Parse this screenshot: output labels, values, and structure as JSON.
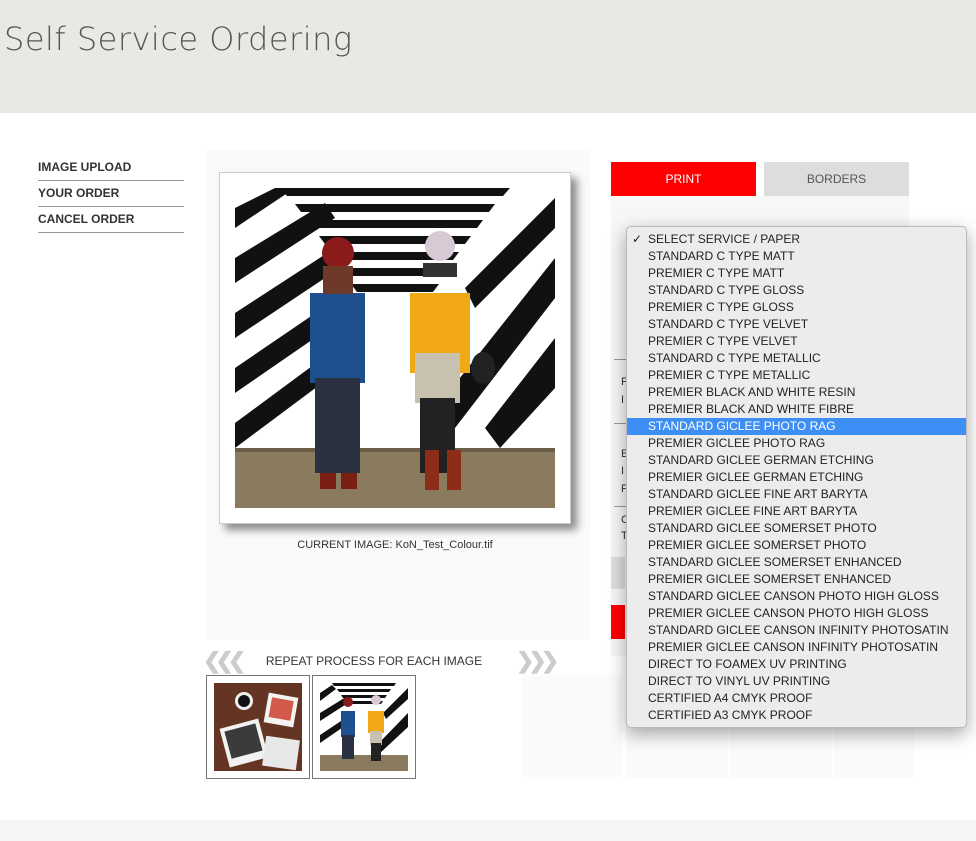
{
  "header": {
    "title": "Self Service Ordering"
  },
  "sidebar": {
    "items": [
      {
        "label": "IMAGE UPLOAD"
      },
      {
        "label": "YOUR ORDER"
      },
      {
        "label": "CANCEL ORDER"
      }
    ]
  },
  "preview": {
    "caption": "CURRENT IMAGE: KoN_Test_Colour.tif"
  },
  "repeat": {
    "label": "REPEAT PROCESS FOR EACH IMAGE",
    "left_arrow": "❮❮❮",
    "right_arrow": "❯❯❯"
  },
  "tabs": [
    {
      "label": "PRINT"
    },
    {
      "label": "BORDERS"
    }
  ],
  "partial_labels": [
    "F",
    "I",
    "E",
    "I",
    "F",
    "C",
    "T"
  ],
  "dropdown": {
    "checkmark": "✓",
    "options": [
      "SELECT SERVICE / PAPER",
      "STANDARD C TYPE MATT",
      "PREMIER C TYPE MATT",
      "STANDARD C TYPE GLOSS",
      "PREMIER C TYPE GLOSS",
      "STANDARD C TYPE VELVET",
      "PREMIER C TYPE VELVET",
      "STANDARD C TYPE METALLIC",
      "PREMIER C TYPE METALLIC",
      "PREMIER BLACK AND WHITE RESIN",
      "PREMIER BLACK AND WHITE FIBRE",
      "STANDARD GICLEE PHOTO RAG",
      "PREMIER GICLEE PHOTO RAG",
      "STANDARD GICLEE GERMAN ETCHING",
      "PREMIER GICLEE GERMAN ETCHING",
      "STANDARD GICLEE FINE ART BARYTA",
      "PREMIER GICLEE FINE ART BARYTA",
      "STANDARD GICLEE SOMERSET PHOTO",
      "PREMIER GICLEE SOMERSET PHOTO",
      "STANDARD GICLEE SOMERSET ENHANCED",
      "PREMIER GICLEE SOMERSET ENHANCED",
      "STANDARD GICLEE CANSON PHOTO HIGH GLOSS",
      "PREMIER GICLEE CANSON PHOTO HIGH GLOSS",
      "STANDARD GICLEE CANSON INFINITY PHOTOSATIN",
      "PREMIER GICLEE CANSON INFINITY PHOTOSATIN",
      "DIRECT TO FOAMEX UV PRINTING",
      "DIRECT TO VINYL UV PRINTING",
      "CERTIFIED A4 CMYK PROOF",
      "CERTIFIED A3 CMYK PROOF"
    ],
    "checked_option": "SELECT SERVICE / PAPER",
    "highlighted_option": "STANDARD GICLEE PHOTO RAG"
  },
  "colors": {
    "accent_red": "#ff0000",
    "highlight_blue": "#3d8ff5",
    "header_bg": "#e9e9e4"
  }
}
